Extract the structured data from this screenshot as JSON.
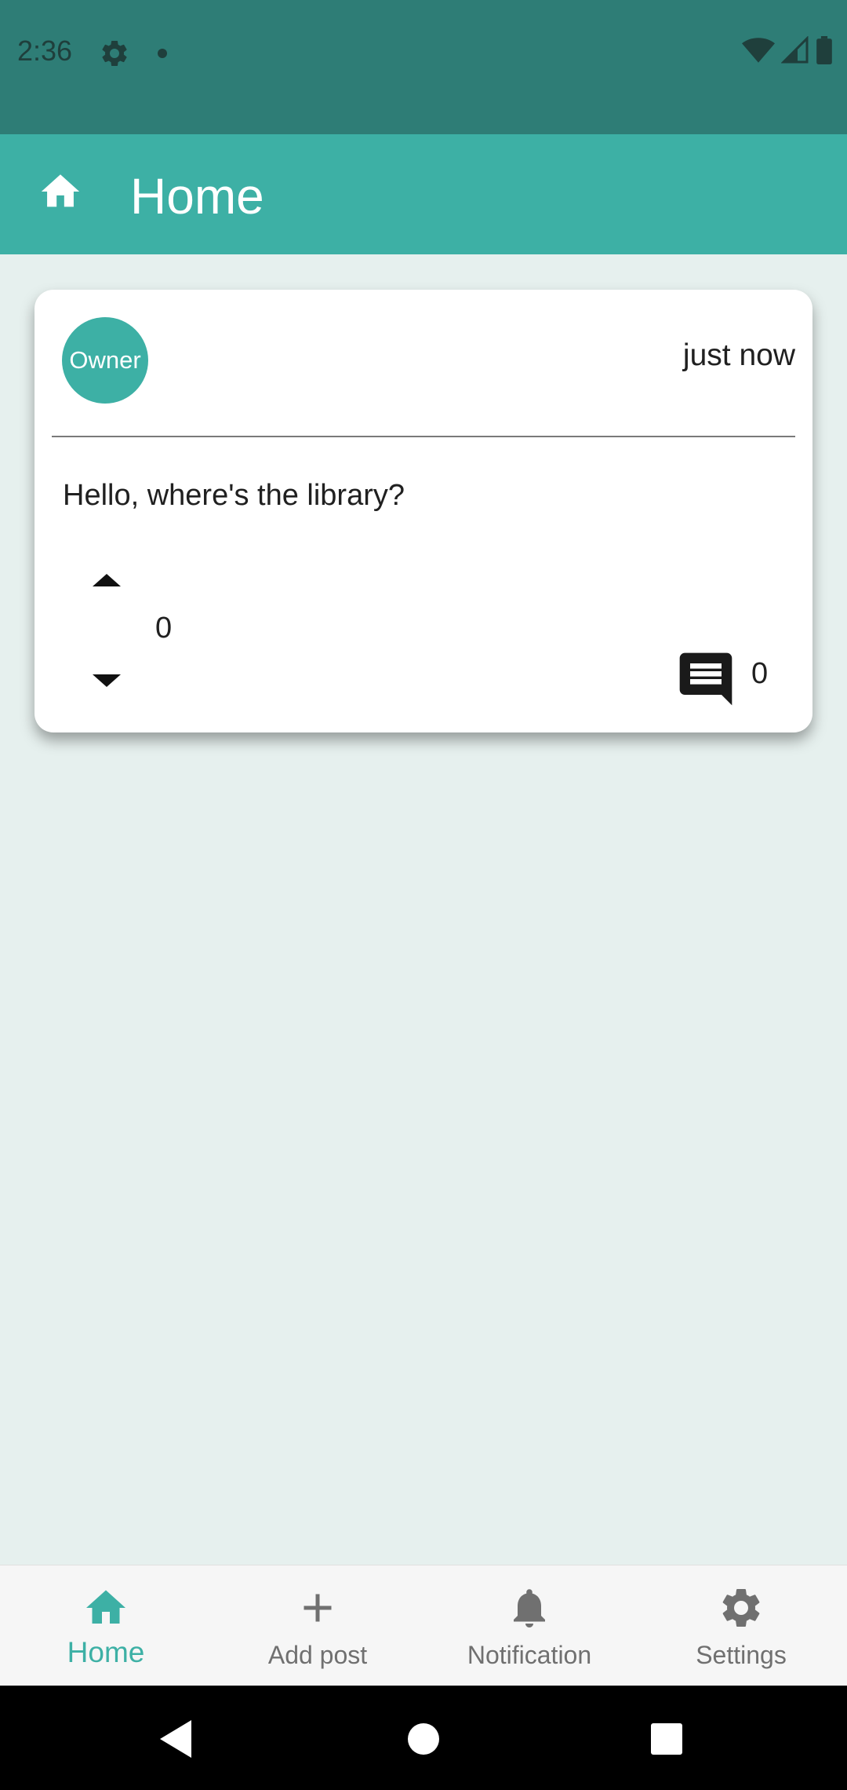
{
  "status_bar": {
    "time": "2:36"
  },
  "app_bar": {
    "title": "Home"
  },
  "post": {
    "author_avatar": "Owner",
    "timestamp": "just now",
    "text": "Hello, where's the library?",
    "votes": "0",
    "comments": "0"
  },
  "bottom_nav": {
    "items": [
      {
        "label": "Home",
        "icon": "home-icon",
        "active": true
      },
      {
        "label": "Add post",
        "icon": "plus-icon",
        "active": false
      },
      {
        "label": "Notification",
        "icon": "bell-icon",
        "active": false
      },
      {
        "label": "Settings",
        "icon": "gear-icon",
        "active": false
      }
    ]
  },
  "colors": {
    "primary": "#3db0a5",
    "status_bar": "#2e7d76",
    "background": "#e6f0ee"
  }
}
